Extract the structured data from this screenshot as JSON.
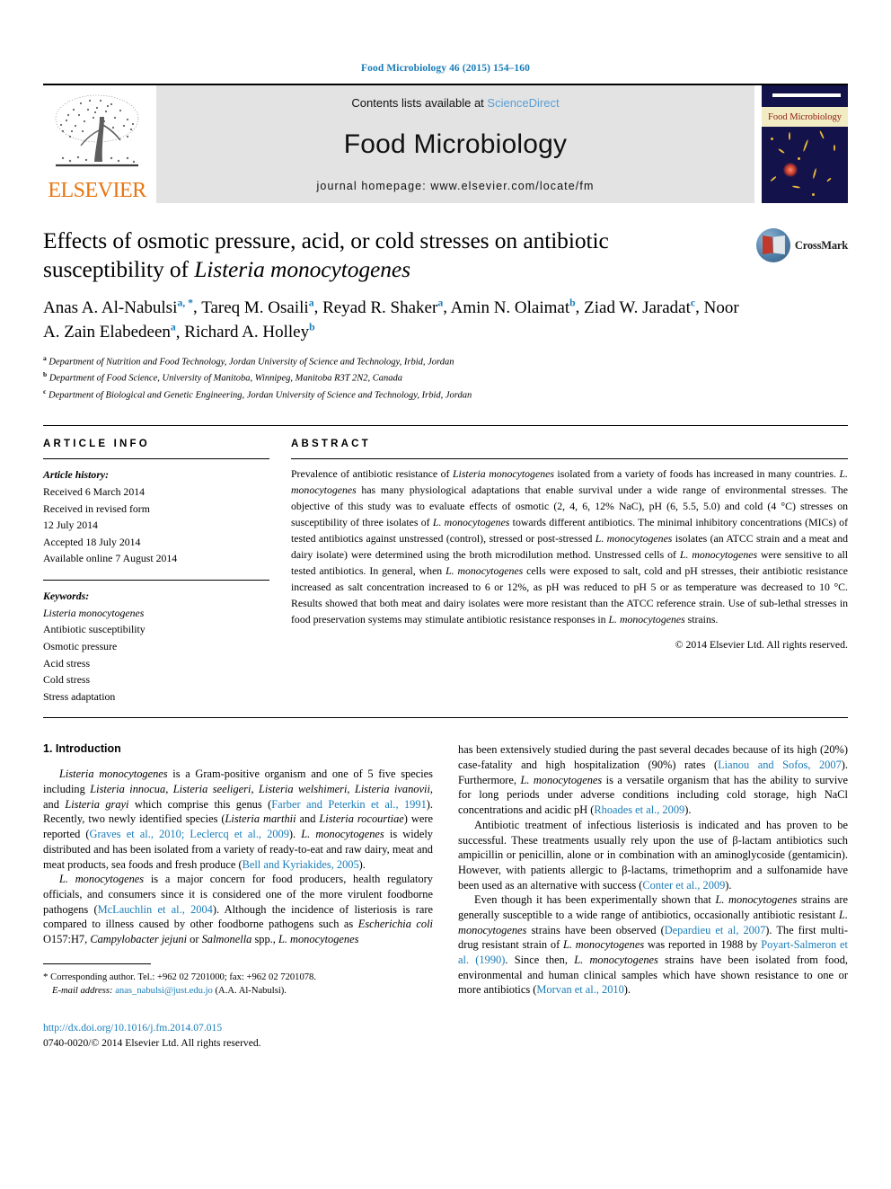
{
  "running_head": "Food Microbiology 46 (2015) 154–160",
  "masthead": {
    "contents_prefix": "Contents lists available at ",
    "sciencedirect": "ScienceDirect",
    "journal_name": "Food Microbiology",
    "homepage": "journal homepage: www.elsevier.com/locate/fm",
    "publisher_word": "ELSEVIER",
    "cover_band_text": "Food Microbiology"
  },
  "crossmark": {
    "label": "CrossMark"
  },
  "title": {
    "line1": "Effects of osmotic pressure, acid, or cold stresses on antibiotic",
    "line2_pre": "susceptibility of ",
    "line2_italic": "Listeria monocytogenes"
  },
  "authors": [
    {
      "name": "Anas A. Al-Nabulsi",
      "marks": "a, *"
    },
    {
      "name": "Tareq M. Osaili",
      "marks": "a"
    },
    {
      "name": "Reyad R. Shaker",
      "marks": "a"
    },
    {
      "name": "Amin N. Olaimat",
      "marks": "b"
    },
    {
      "name": "Ziad W. Jaradat",
      "marks": "c"
    },
    {
      "name": "Noor A. Zain Elabedeen",
      "marks": "a"
    },
    {
      "name": "Richard A. Holley",
      "marks": "b"
    }
  ],
  "affiliations": [
    {
      "mark": "a",
      "text": "Department of Nutrition and Food Technology, Jordan University of Science and Technology, Irbid, Jordan"
    },
    {
      "mark": "b",
      "text": "Department of Food Science, University of Manitoba, Winnipeg, Manitoba R3T 2N2, Canada"
    },
    {
      "mark": "c",
      "text": "Department of Biological and Genetic Engineering, Jordan University of Science and Technology, Irbid, Jordan"
    }
  ],
  "article_info": {
    "heading": "ARTICLE INFO",
    "history_label": "Article history:",
    "history": [
      "Received 6 March 2014",
      "Received in revised form",
      "12 July 2014",
      "Accepted 18 July 2014",
      "Available online 7 August 2014"
    ],
    "keywords_label": "Keywords:",
    "keywords": [
      "Listeria monocytogenes",
      "Antibiotic susceptibility",
      "Osmotic pressure",
      "Acid stress",
      "Cold stress",
      "Stress adaptation"
    ],
    "keyword_italic_index": 0
  },
  "abstract": {
    "heading": "ABSTRACT",
    "paragraph": "Prevalence of antibiotic resistance of Listeria monocytogenes isolated from a variety of foods has increased in many countries. L. monocytogenes has many physiological adaptations that enable survival under a wide range of environmental stresses. The objective of this study was to evaluate effects of osmotic (2, 4, 6, 12% NaC), pH (6, 5.5, 5.0) and cold (4 °C) stresses on susceptibility of three isolates of L. monocytogenes towards different antibiotics. The minimal inhibitory concentrations (MICs) of tested antibiotics against unstressed (control), stressed or post-stressed L. monocytogenes isolates (an ATCC strain and a meat and dairy isolate) were determined using the broth microdilution method. Unstressed cells of L. monocytogenes were sensitive to all tested antibiotics. In general, when L. monocytogenes cells were exposed to salt, cold and pH stresses, their antibiotic resistance increased as salt concentration increased to 6 or 12%, as pH was reduced to pH 5 or as temperature was decreased to 10 °C. Results showed that both meat and dairy isolates were more resistant than the ATCC reference strain. Use of sub-lethal stresses in food preservation systems may stimulate antibiotic resistance responses in L. monocytogenes strains.",
    "copyright": "© 2014 Elsevier Ltd. All rights reserved."
  },
  "body": {
    "section_number_title": "1.  Introduction",
    "left_paragraphs": [
      "Listeria monocytogenes is a Gram-positive organism and one of 5 five species including Listeria innocua, Listeria seeligeri, Listeria welshimeri, Listeria ivanovii, and Listeria grayi which comprise this genus (Farber and Peterkin et al., 1991). Recently, two newly identified species (Listeria marthii and Listeria rocourtiae) were reported (Graves et al., 2010; Leclercq et al., 2009). L. monocytogenes is widely distributed and has been isolated from a variety of ready-to-eat and raw dairy, meat and meat products, sea foods and fresh produce (Bell and Kyriakides, 2005).",
      "L. monocytogenes is a major concern for food producers, health regulatory officials, and consumers since it is considered one of the more virulent foodborne pathogens (McLauchlin et al., 2004). Although the incidence of listeriosis is rare compared to illness caused by other foodborne pathogens such as Escherichia coli O157:H7, Campylobacter jejuni or Salmonella spp., L. monocytogenes"
    ],
    "right_paragraphs": [
      "has been extensively studied during the past several decades because of its high (20%) case-fatality and high hospitalization (90%) rates (Lianou and Sofos, 2007). Furthermore, L. monocytogenes is a versatile organism that has the ability to survive for long periods under adverse conditions including cold storage, high NaCl concentrations and acidic pH (Rhoades et al., 2009).",
      "Antibiotic treatment of infectious listeriosis is indicated and has proven to be successful. These treatments usually rely upon the use of β-lactam antibiotics such ampicillin or penicillin, alone or in combination with an aminoglycoside (gentamicin). However, with patients allergic to β-lactams, trimethoprim and a sulfonamide have been used as an alternative with success (Conter et al., 2009).",
      "Even though it has been experimentally shown that L. monocytogenes strains are generally susceptible to a wide range of antibiotics, occasionally antibiotic resistant L. monocytogenes strains have been observed (Depardieu et al, 2007). The first multi-drug resistant strain of L. monocytogenes was reported in 1988 by Poyart-Salmeron et al. (1990). Since then, L. monocytogenes strains have been isolated from food, environmental and human clinical samples which have shown resistance to one or more antibiotics (Morvan et al., 2010)."
    ]
  },
  "footnote": {
    "star": "*",
    "corresponding": "Corresponding author. Tel.: +962 02 7201000; fax: +962 02 7201078.",
    "email_label": "E-mail address:",
    "email": "anas_nabulsi@just.edu.jo",
    "email_suffix": "(A.A. Al-Nabulsi)."
  },
  "doi_block": {
    "doi_url": "http://dx.doi.org/10.1016/j.fm.2014.07.015",
    "issn_line": "0740-0020/© 2014 Elsevier Ltd. All rights reserved."
  },
  "colors": {
    "link_blue": "#1a7cb8",
    "sciencedirect_blue": "#5a9fd4",
    "elsevier_orange": "#e87511",
    "masthead_gray": "#e3e3e3",
    "cover_navy": "#13124a",
    "cover_band": "#f2ecc4"
  }
}
